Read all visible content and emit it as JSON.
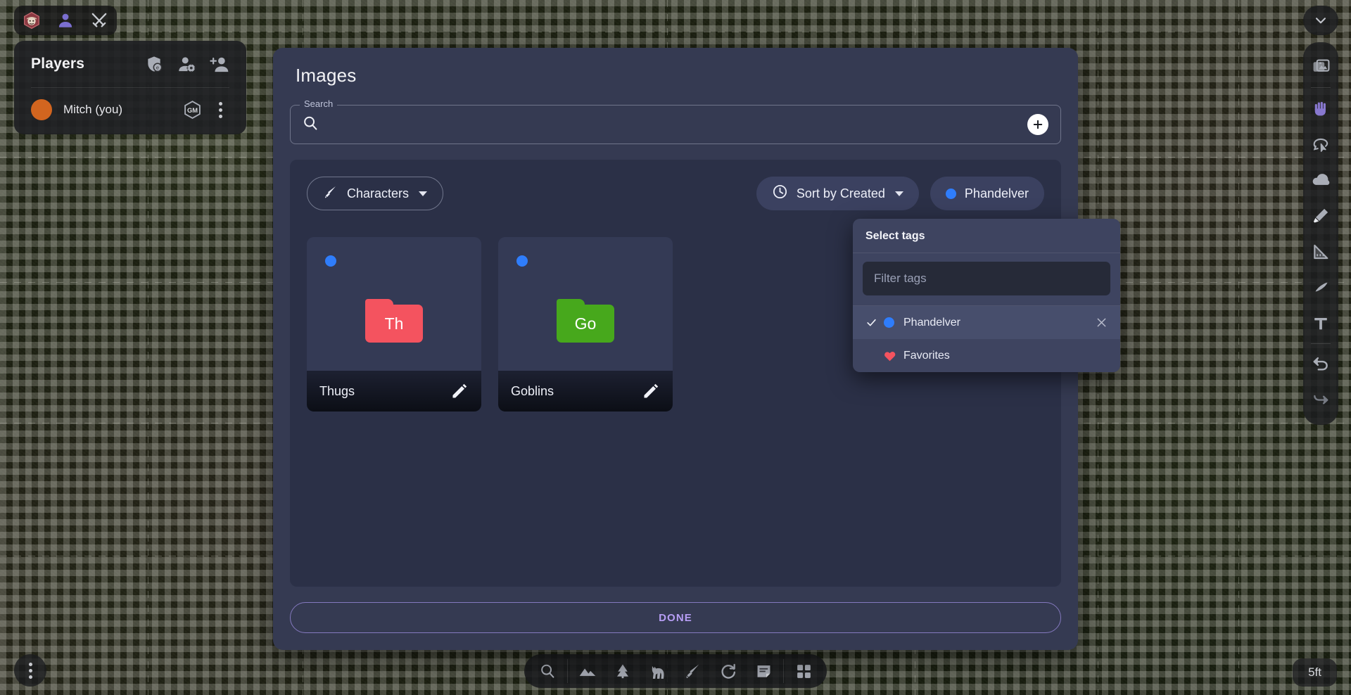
{
  "map": {
    "scale_label": "5ft",
    "grid_visible": true
  },
  "topbar": {
    "icons": [
      {
        "name": "character-portrait-icon",
        "label": "Character"
      },
      {
        "name": "player-icon",
        "label": "Players"
      },
      {
        "name": "combat-swords-icon",
        "label": "Combat"
      }
    ]
  },
  "players_panel": {
    "title": "Players",
    "actions": [
      {
        "name": "invite-shield-icon",
        "label": "Invite"
      },
      {
        "name": "manage-players-icon",
        "label": "Manage players"
      },
      {
        "name": "add-player-icon",
        "label": "Add player"
      }
    ],
    "rows": [
      {
        "name": "Mitch (you)",
        "color": "#d2651f",
        "badge": "GM"
      }
    ]
  },
  "dialog": {
    "title": "Images",
    "search": {
      "label": "Search",
      "value": "",
      "placeholder": ""
    },
    "add_button_label": "+",
    "filters": {
      "category_label": "Characters",
      "sort_label": "Sort by Created",
      "tag_label": "Phandelver",
      "tag_color": "#2f7dfb"
    },
    "cards": [
      {
        "name": "Thugs",
        "abbrev": "Th",
        "color": "#f4535f",
        "tag_color": "#2f7dfb"
      },
      {
        "name": "Goblins",
        "abbrev": "Go",
        "color": "#47a81c",
        "tag_color": "#2f7dfb"
      }
    ],
    "done_label": "DONE"
  },
  "tag_menu": {
    "title": "Select tags",
    "filter_placeholder": "Filter tags",
    "filter_value": "",
    "items": [
      {
        "label": "Phandelver",
        "color": "#2f7dfb",
        "selected": true,
        "removable": true,
        "icon": "dot"
      },
      {
        "label": "Favorites",
        "color": "#f4535f",
        "selected": false,
        "removable": false,
        "icon": "heart"
      }
    ]
  },
  "right_toolbar": {
    "collapse": {
      "name": "chevron-down-icon"
    },
    "tools": [
      {
        "name": "images-tool",
        "icon": "images-icon",
        "active": false
      },
      {
        "name": "pan-tool",
        "icon": "hand-icon",
        "active": true
      },
      {
        "name": "select-tool",
        "icon": "lasso-select-icon",
        "active": false
      },
      {
        "name": "fog-tool",
        "icon": "cloud-icon",
        "active": false
      },
      {
        "name": "draw-tool",
        "icon": "pen-icon",
        "active": false
      },
      {
        "name": "measure-tool",
        "icon": "ruler-icon",
        "active": false
      },
      {
        "name": "shape-tool",
        "icon": "teardrop-icon",
        "active": false
      },
      {
        "name": "text-tool",
        "icon": "text-t-icon",
        "active": false
      },
      {
        "name": "undo-button",
        "icon": "undo-icon",
        "active": false
      },
      {
        "name": "redo-button",
        "icon": "redo-icon",
        "active": false
      }
    ]
  },
  "bottom_toolbar": {
    "tools": [
      {
        "name": "search-tool",
        "icon": "magnifier-icon"
      },
      {
        "name": "maps-tool",
        "icon": "mountains-icon"
      },
      {
        "name": "scenery-tool",
        "icon": "tree-icon"
      },
      {
        "name": "creatures-tool",
        "icon": "horse-icon"
      },
      {
        "name": "items-tool",
        "icon": "sword-icon"
      },
      {
        "name": "effects-tool",
        "icon": "circle-arrow-icon"
      },
      {
        "name": "notes-tool",
        "icon": "note-icon"
      },
      {
        "name": "grid-tool",
        "icon": "grid-icon"
      }
    ]
  },
  "bottom_left": {
    "more_label": "More options"
  }
}
